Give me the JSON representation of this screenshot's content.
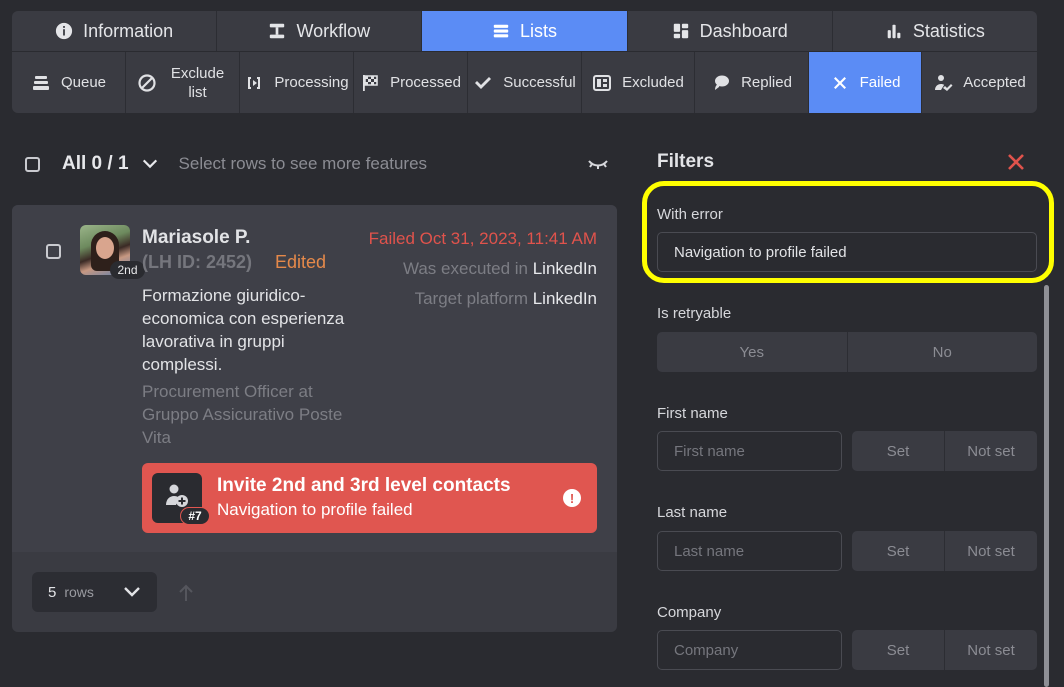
{
  "tabs": [
    {
      "label": "Information",
      "icon": "info-icon"
    },
    {
      "label": "Workflow",
      "icon": "workflow-icon"
    },
    {
      "label": "Lists",
      "icon": "lists-icon",
      "active": true
    },
    {
      "label": "Dashboard",
      "icon": "dashboard-icon"
    },
    {
      "label": "Statistics",
      "icon": "statistics-icon"
    }
  ],
  "subtabs": [
    {
      "label": "Queue",
      "icon": "queue-icon"
    },
    {
      "label": "Exclude list",
      "icon": "exclude-icon"
    },
    {
      "label": "Processing",
      "icon": "processing-icon"
    },
    {
      "label": "Processed",
      "icon": "checkered-flag-icon"
    },
    {
      "label": "Successful",
      "icon": "checkmark-icon"
    },
    {
      "label": "Excluded",
      "icon": "excluded-icon"
    },
    {
      "label": "Replied",
      "icon": "replied-icon"
    },
    {
      "label": "Failed",
      "icon": "x-icon",
      "active": true
    },
    {
      "label": "Accepted",
      "icon": "accepted-icon"
    }
  ],
  "selection": {
    "all_label": "All 0 / 1",
    "hint": "Select rows to see more features"
  },
  "contact": {
    "name": "Mariasole P.",
    "lh_id": "(LH ID: 2452)",
    "edited": "Edited",
    "degree": "2nd",
    "headline": "Formazione giuridico-economica con esperienza lavorativa in gruppi complessi.",
    "position": "Procurement Officer at Gruppo Assicurativo Poste Vita",
    "failed_date": "Failed Oct 31, 2023, 11:41 AM",
    "executed_label": "Was executed in",
    "executed_value": "LinkedIn",
    "target_label": "Target platform",
    "target_value": "LinkedIn",
    "action_title": "Invite 2nd and 3rd level contacts",
    "action_error": "Navigation to profile failed",
    "step": "#7"
  },
  "pagination": {
    "rows_num": "5",
    "rows_label": "rows"
  },
  "filters": {
    "title": "Filters",
    "with_error": {
      "label": "With error",
      "value": "Navigation to profile failed"
    },
    "retryable": {
      "label": "Is retryable",
      "yes": "Yes",
      "no": "No"
    },
    "first_name": {
      "label": "First name",
      "placeholder": "First name",
      "set": "Set",
      "not_set": "Not set"
    },
    "last_name": {
      "label": "Last name",
      "placeholder": "Last name",
      "set": "Set",
      "not_set": "Not set"
    },
    "company": {
      "label": "Company",
      "placeholder": "Company",
      "set": "Set",
      "not_set": "Not set"
    }
  },
  "colors": {
    "accent": "#5b8cf5",
    "error": "#e05650",
    "edited": "#e5894a",
    "highlight": "#ffff00"
  }
}
